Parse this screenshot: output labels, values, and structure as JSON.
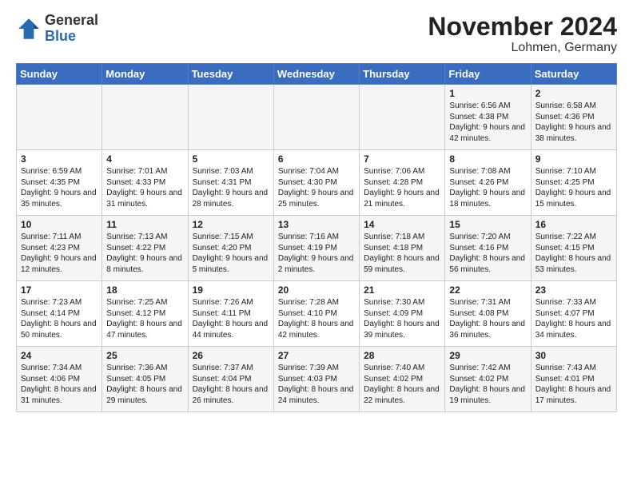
{
  "header": {
    "logo_general": "General",
    "logo_blue": "Blue",
    "month_title": "November 2024",
    "location": "Lohmen, Germany"
  },
  "days_of_week": [
    "Sunday",
    "Monday",
    "Tuesday",
    "Wednesday",
    "Thursday",
    "Friday",
    "Saturday"
  ],
  "weeks": [
    [
      {
        "day": "",
        "info": ""
      },
      {
        "day": "",
        "info": ""
      },
      {
        "day": "",
        "info": ""
      },
      {
        "day": "",
        "info": ""
      },
      {
        "day": "",
        "info": ""
      },
      {
        "day": "1",
        "info": "Sunrise: 6:56 AM\nSunset: 4:38 PM\nDaylight: 9 hours\nand 42 minutes."
      },
      {
        "day": "2",
        "info": "Sunrise: 6:58 AM\nSunset: 4:36 PM\nDaylight: 9 hours\nand 38 minutes."
      }
    ],
    [
      {
        "day": "3",
        "info": "Sunrise: 6:59 AM\nSunset: 4:35 PM\nDaylight: 9 hours\nand 35 minutes."
      },
      {
        "day": "4",
        "info": "Sunrise: 7:01 AM\nSunset: 4:33 PM\nDaylight: 9 hours\nand 31 minutes."
      },
      {
        "day": "5",
        "info": "Sunrise: 7:03 AM\nSunset: 4:31 PM\nDaylight: 9 hours\nand 28 minutes."
      },
      {
        "day": "6",
        "info": "Sunrise: 7:04 AM\nSunset: 4:30 PM\nDaylight: 9 hours\nand 25 minutes."
      },
      {
        "day": "7",
        "info": "Sunrise: 7:06 AM\nSunset: 4:28 PM\nDaylight: 9 hours\nand 21 minutes."
      },
      {
        "day": "8",
        "info": "Sunrise: 7:08 AM\nSunset: 4:26 PM\nDaylight: 9 hours\nand 18 minutes."
      },
      {
        "day": "9",
        "info": "Sunrise: 7:10 AM\nSunset: 4:25 PM\nDaylight: 9 hours\nand 15 minutes."
      }
    ],
    [
      {
        "day": "10",
        "info": "Sunrise: 7:11 AM\nSunset: 4:23 PM\nDaylight: 9 hours\nand 12 minutes."
      },
      {
        "day": "11",
        "info": "Sunrise: 7:13 AM\nSunset: 4:22 PM\nDaylight: 9 hours\nand 8 minutes."
      },
      {
        "day": "12",
        "info": "Sunrise: 7:15 AM\nSunset: 4:20 PM\nDaylight: 9 hours\nand 5 minutes."
      },
      {
        "day": "13",
        "info": "Sunrise: 7:16 AM\nSunset: 4:19 PM\nDaylight: 9 hours\nand 2 minutes."
      },
      {
        "day": "14",
        "info": "Sunrise: 7:18 AM\nSunset: 4:18 PM\nDaylight: 8 hours\nand 59 minutes."
      },
      {
        "day": "15",
        "info": "Sunrise: 7:20 AM\nSunset: 4:16 PM\nDaylight: 8 hours\nand 56 minutes."
      },
      {
        "day": "16",
        "info": "Sunrise: 7:22 AM\nSunset: 4:15 PM\nDaylight: 8 hours\nand 53 minutes."
      }
    ],
    [
      {
        "day": "17",
        "info": "Sunrise: 7:23 AM\nSunset: 4:14 PM\nDaylight: 8 hours\nand 50 minutes."
      },
      {
        "day": "18",
        "info": "Sunrise: 7:25 AM\nSunset: 4:12 PM\nDaylight: 8 hours\nand 47 minutes."
      },
      {
        "day": "19",
        "info": "Sunrise: 7:26 AM\nSunset: 4:11 PM\nDaylight: 8 hours\nand 44 minutes."
      },
      {
        "day": "20",
        "info": "Sunrise: 7:28 AM\nSunset: 4:10 PM\nDaylight: 8 hours\nand 42 minutes."
      },
      {
        "day": "21",
        "info": "Sunrise: 7:30 AM\nSunset: 4:09 PM\nDaylight: 8 hours\nand 39 minutes."
      },
      {
        "day": "22",
        "info": "Sunrise: 7:31 AM\nSunset: 4:08 PM\nDaylight: 8 hours\nand 36 minutes."
      },
      {
        "day": "23",
        "info": "Sunrise: 7:33 AM\nSunset: 4:07 PM\nDaylight: 8 hours\nand 34 minutes."
      }
    ],
    [
      {
        "day": "24",
        "info": "Sunrise: 7:34 AM\nSunset: 4:06 PM\nDaylight: 8 hours\nand 31 minutes."
      },
      {
        "day": "25",
        "info": "Sunrise: 7:36 AM\nSunset: 4:05 PM\nDaylight: 8 hours\nand 29 minutes."
      },
      {
        "day": "26",
        "info": "Sunrise: 7:37 AM\nSunset: 4:04 PM\nDaylight: 8 hours\nand 26 minutes."
      },
      {
        "day": "27",
        "info": "Sunrise: 7:39 AM\nSunset: 4:03 PM\nDaylight: 8 hours\nand 24 minutes."
      },
      {
        "day": "28",
        "info": "Sunrise: 7:40 AM\nSunset: 4:02 PM\nDaylight: 8 hours\nand 22 minutes."
      },
      {
        "day": "29",
        "info": "Sunrise: 7:42 AM\nSunset: 4:02 PM\nDaylight: 8 hours\nand 19 minutes."
      },
      {
        "day": "30",
        "info": "Sunrise: 7:43 AM\nSunset: 4:01 PM\nDaylight: 8 hours\nand 17 minutes."
      }
    ]
  ]
}
